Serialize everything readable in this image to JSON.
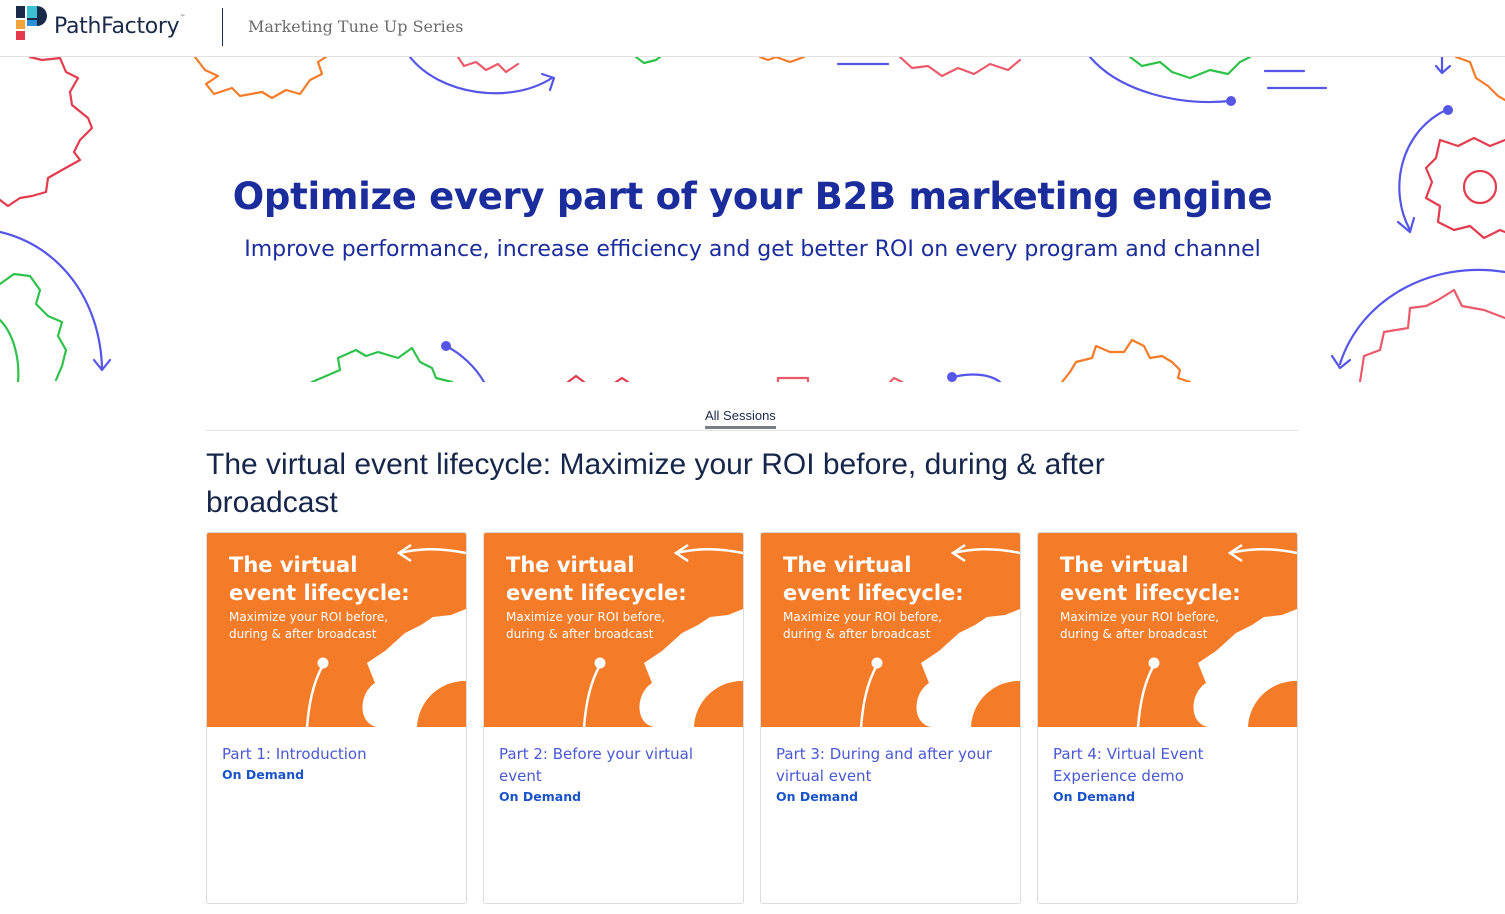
{
  "header": {
    "brand": "PathFactory",
    "brand_tm": "™",
    "series_title": "Marketing Tune Up Series"
  },
  "hero": {
    "title": "Optimize every part of your B2B marketing engine",
    "subtitle": "Improve performance, increase efficiency and get better ROI on every program and channel"
  },
  "tabs": [
    {
      "label": "All Sessions",
      "active": true
    }
  ],
  "section": {
    "title": "The virtual event lifecycle: Maximize your ROI before, during & after broadcast"
  },
  "card_thumbnail": {
    "line1": "The virtual",
    "line2": "event lifecycle:",
    "line3": "Maximize your ROI before,",
    "line4": "during & after broadcast"
  },
  "cards": [
    {
      "title": "Part 1: Introduction",
      "meta": "On Demand"
    },
    {
      "title": "Part 2: Before your virtual event",
      "meta": "On Demand"
    },
    {
      "title": "Part 3: During and after your virtual event",
      "meta": "On Demand"
    },
    {
      "title": "Part 4: Virtual Event Experience demo",
      "meta": "On Demand"
    }
  ],
  "colors": {
    "brand_blue": "#1b2c9c",
    "thumb_orange": "#f47b28",
    "link_blue": "#4a58d4",
    "meta_blue": "#1a52c8",
    "gear_red": "#e23b4e",
    "gear_green": "#2ec24a",
    "gear_orange": "#f47b28",
    "arrow_purple": "#5555e8",
    "gear_pink": "#ea5a6a"
  },
  "icons": [
    "pathfactory-logo-icon",
    "gear-icon",
    "arrow-icon"
  ]
}
